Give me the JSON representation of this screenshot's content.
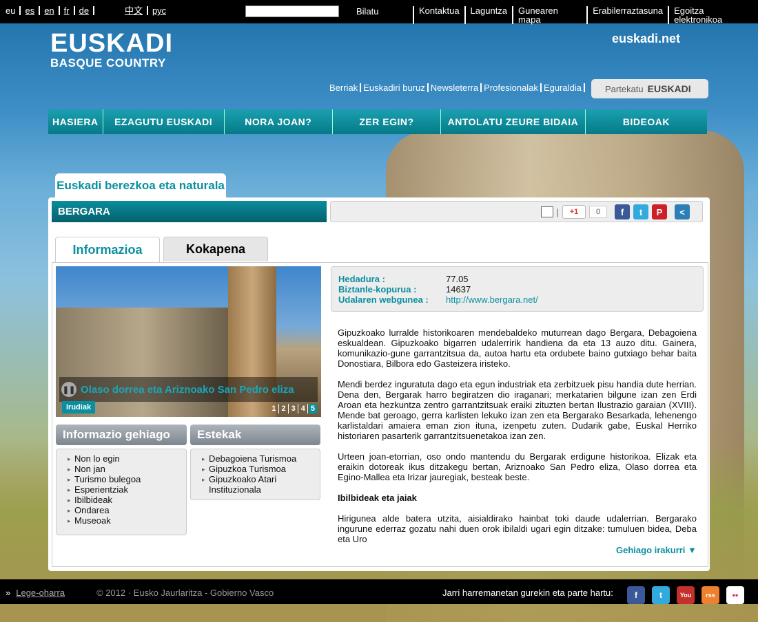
{
  "topbar": {
    "langs": [
      "eu",
      "es",
      "en",
      "fr",
      "de"
    ],
    "langs2": [
      "中文",
      "рус"
    ],
    "search_button": "Bilatu",
    "links": [
      "Kontaktua",
      "Laguntza",
      "Gunearen mapa",
      "Erabilerraztasuna",
      "Egoitza elektronikoa"
    ]
  },
  "header": {
    "logo_line1": "EUSKADI",
    "logo_line2": "BASQUE COUNTRY",
    "euskadinet": "euskadi.net",
    "sublinks": [
      "Berriak",
      "Euskadiri buruz",
      "Newsleterra",
      "Profesionalak",
      "Eguraldia"
    ],
    "partekatu": "Partekatu",
    "partekatu_brand": "EUSKADI"
  },
  "nav": [
    "HASIERA",
    "EZAGUTU EUSKADI",
    "NORA JOAN?",
    "ZER EGIN?",
    "ANTOLATU ZEURE BIDAIA",
    "BIDEOAK"
  ],
  "section_title": "Euskadi berezkoa eta naturala",
  "page_title": "BERGARA",
  "share": {
    "gplus": "+1",
    "gplus_count": "0",
    "facebook": "f",
    "twitter": "t",
    "pinterest": "P",
    "more": "<"
  },
  "tabs": {
    "info": "Informazioa",
    "location": "Kokapena"
  },
  "photo": {
    "caption": "Olaso dorrea eta Ariznoako San Pedro eliza",
    "label": "Irudiak",
    "pages": [
      "1",
      "2",
      "3",
      "4",
      "5"
    ]
  },
  "info_box": {
    "title": "Informazio gehiago",
    "items": [
      "Non lo egin",
      "Non jan",
      "Turismo bulegoa",
      "Esperientziak",
      "Ibilbideak",
      "Ondarea",
      "Museoak"
    ]
  },
  "links_box": {
    "title": "Estekak",
    "items": [
      "Debagoiena Turismoa",
      "Gipuzkoa Turismoa",
      "Gipuzkoako Atari Instituzionala"
    ]
  },
  "facts": [
    {
      "label": "Hedadura :",
      "value": "77.05"
    },
    {
      "label": "Biztanle-kopurua :",
      "value": "14637"
    },
    {
      "label": "Udalaren webgunea :",
      "value": "http://www.bergara.net/"
    }
  ],
  "body": {
    "p1": "Gipuzkoako lurralde historikoaren mendebaldeko muturrean dago Bergara, Debagoiena eskualdean. Gipuzkoako bigarren udalerririk handiena da eta 13 auzo ditu. Gainera, komunikazio-gune garrantzitsua da, autoa hartu eta ordubete baino gutxiago behar baita Donostiara, Bilbora edo Gasteizera iristeko.",
    "p2": "Mendi berdez inguratuta dago eta egun industriak eta zerbitzuek pisu handia dute herrian. Dena den, Bergarak harro begiratzen dio iraganari; merkatarien bilgune izan zen Erdi Aroan eta hezkuntza zentro garrantzitsuak eraiki zituzten bertan Ilustrazio garaian (XVIII). Mende bat geroago, gerra karlisten lekuko izan zen eta Bergarako Besarkada, lehenengo karlistaldari amaiera eman zion ituna, izenpetu zuten. Dudarik gabe, Euskal Herriko historiaren pasarterik garrantzitsuenetakoa izan zen.",
    "p3": "Urteen joan-etorrian, oso ondo mantendu du Bergarak erdigune historikoa. Elizak eta eraikin dotoreak ikus ditzakegu bertan, Ariznoako San Pedro eliza, Olaso dorrea eta Egino-Mallea eta Irizar jauregiak, besteak beste.",
    "h1": "Ibilbideak eta jaiak",
    "p4": "Hirigunea alde batera utzita, aisialdirako hainbat toki daude udalerrian. Bergarako ingurune ederraz gozatu nahi duen orok ibilaldi ugari egin ditzake: tumuluen bidea, Deba eta Uro",
    "more": "Gehiago irakurri ▼"
  },
  "footer": {
    "legal": "Lege-oharra",
    "copyright": "© 2012 · Eusko Jaurlaritza - Gobierno Vasco",
    "contact": "Jarri harremanetan gurekin eta parte hartu:",
    "social": [
      "f",
      "t",
      "You",
      "rss",
      "••"
    ]
  },
  "colors": {
    "accent": "#0a8fa0",
    "topbar": "#000000"
  }
}
